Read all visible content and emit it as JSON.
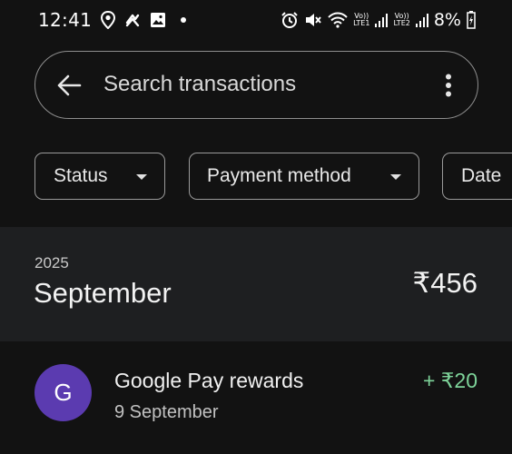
{
  "status_bar": {
    "time": "12:41",
    "left_icons": [
      "location-icon",
      "sync-icon",
      "gallery-icon",
      "notification-dot"
    ],
    "right_icons": [
      "alarm-icon",
      "mute-icon",
      "wifi-icon",
      "sim1-signal-icon",
      "sim2-signal-icon",
      "battery-icon"
    ],
    "sim1_label_top": "Vo))",
    "sim1_label_bottom": "LTE1",
    "sim2_label_top": "Vo))",
    "sim2_label_bottom": "LTE2",
    "battery": "8%"
  },
  "search": {
    "placeholder": "Search transactions"
  },
  "filters": [
    {
      "label": "Status"
    },
    {
      "label": "Payment method"
    },
    {
      "label": "Date"
    }
  ],
  "month_summary": {
    "year": "2025",
    "month": "September",
    "total": "₹456"
  },
  "transactions": [
    {
      "avatar_letter": "G",
      "name": "Google Pay rewards",
      "date": "9 September",
      "amount": "+ ₹20"
    }
  ],
  "colors": {
    "background": "#121212",
    "band": "#1e1f21",
    "avatar": "#5b3bb0",
    "credit": "#7ed49a"
  }
}
